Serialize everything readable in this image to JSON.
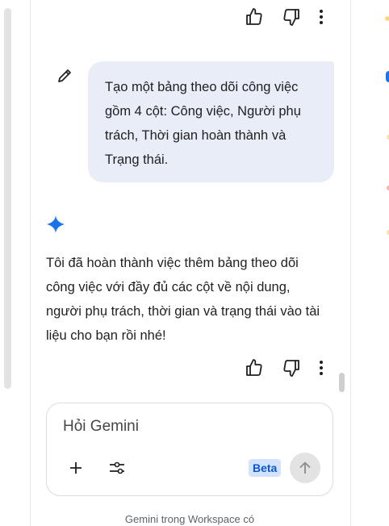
{
  "messages": {
    "user_prompt": "Tạo một bảng theo dõi công việc gồm 4 cột: Công việc, Người phụ trách, Thời gian hoàn thành và Trạng thái.",
    "model_response": "Tôi đã hoàn thành việc thêm bảng theo dõi công việc với đầy đủ các cột về nội dung, người phụ trách, thời gian và trạng thái vào tài liệu cho bạn rồi nhé!"
  },
  "composer": {
    "placeholder": "Hỏi Gemini",
    "beta_label": "Beta"
  },
  "footer": {
    "note": "Gemini trong Workspace có"
  },
  "icons": {
    "thumbs_up": "thumbs-up-icon",
    "thumbs_down": "thumbs-down-icon",
    "more": "more-vert-icon",
    "edit": "pencil-icon",
    "sparkle": "gemini-sparkle-icon",
    "add": "plus-icon",
    "tools": "tools-icon",
    "send": "arrow-up-icon"
  },
  "colors": {
    "user_bubble": "#e8edf7",
    "sparkle": "#1a73e8",
    "beta_bg": "#d3e3fd",
    "beta_text": "#0b57d0"
  }
}
